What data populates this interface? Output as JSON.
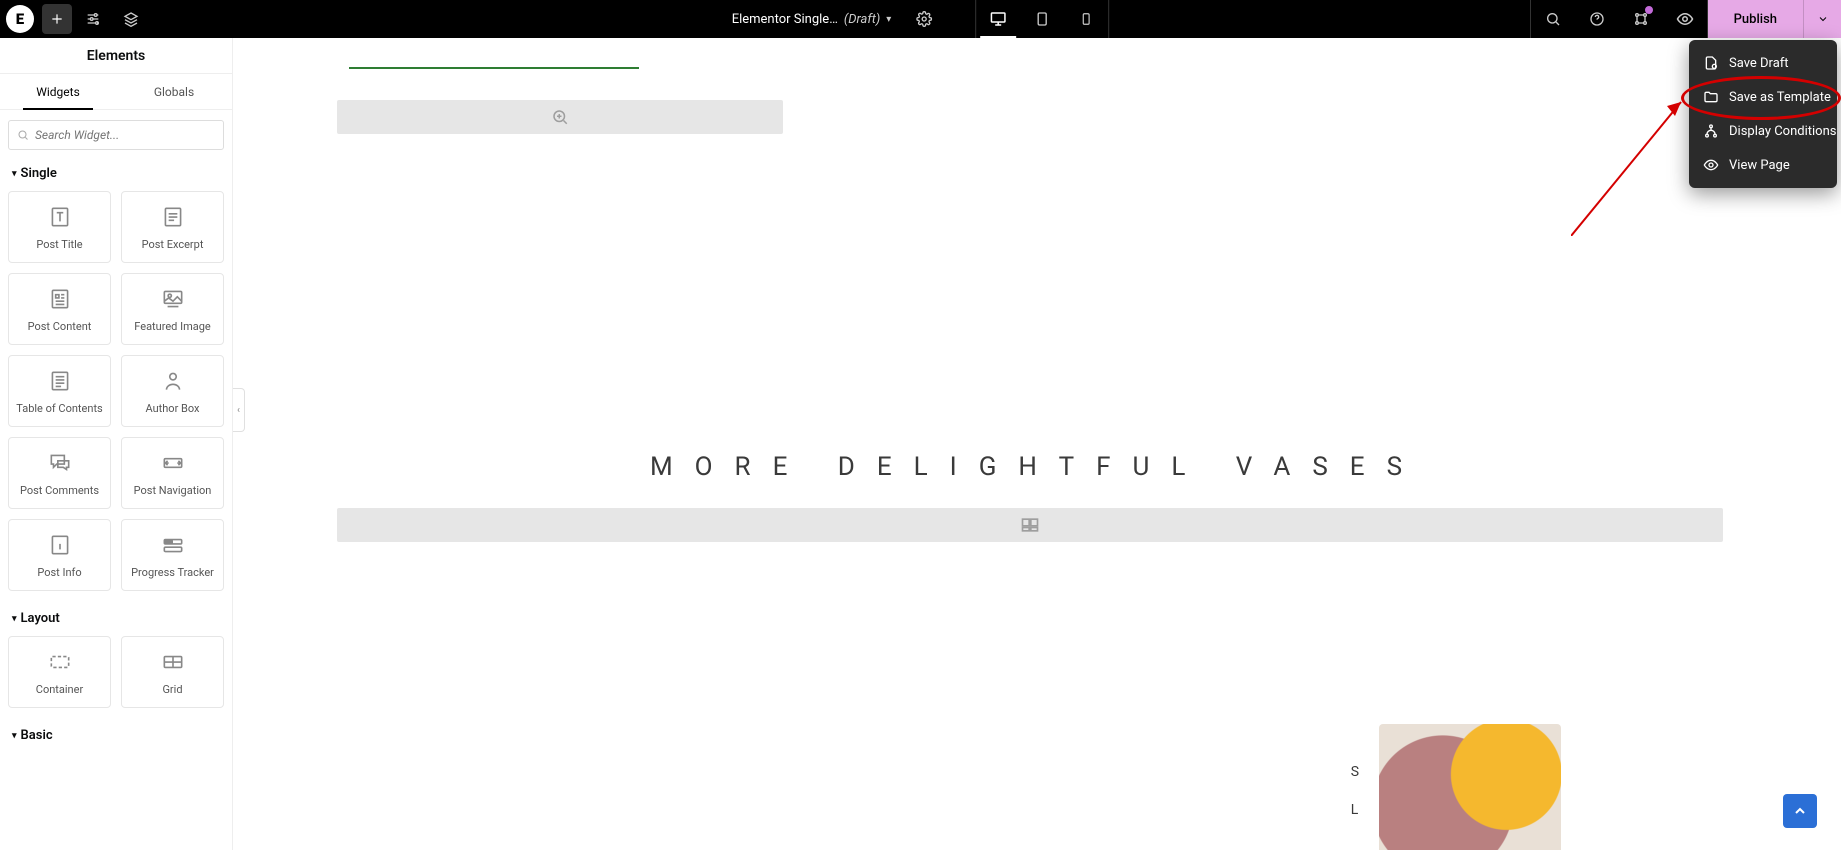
{
  "topbar": {
    "doc_title": "Elementor Single…",
    "draft_label": "(Draft)",
    "publish_label": "Publish"
  },
  "publish_menu": {
    "save_draft": "Save Draft",
    "save_template": "Save as Template",
    "display_conditions": "Display Conditions",
    "view_page": "View Page"
  },
  "panel": {
    "title": "Elements",
    "tab_widgets": "Widgets",
    "tab_globals": "Globals",
    "search_placeholder": "Search Widget..."
  },
  "categories": {
    "single": "Single",
    "layout": "Layout",
    "basic": "Basic"
  },
  "widgets_single": [
    {
      "label": "Post Title"
    },
    {
      "label": "Post Excerpt"
    },
    {
      "label": "Post Content"
    },
    {
      "label": "Featured Image"
    },
    {
      "label": "Table of Contents"
    },
    {
      "label": "Author Box"
    },
    {
      "label": "Post Comments"
    },
    {
      "label": "Post Navigation"
    },
    {
      "label": "Post Info"
    },
    {
      "label": "Progress Tracker"
    }
  ],
  "widgets_layout": [
    {
      "label": "Container"
    },
    {
      "label": "Grid"
    }
  ],
  "canvas": {
    "heading": "MORE DELIGHTFUL VASES",
    "side_letters": [
      "S",
      "L"
    ]
  },
  "colors": {
    "publish_bg": "#e6a9e6",
    "annotation": "#d40000",
    "green_line": "#2e7d32",
    "scroll_top": "#2b6fd6"
  }
}
